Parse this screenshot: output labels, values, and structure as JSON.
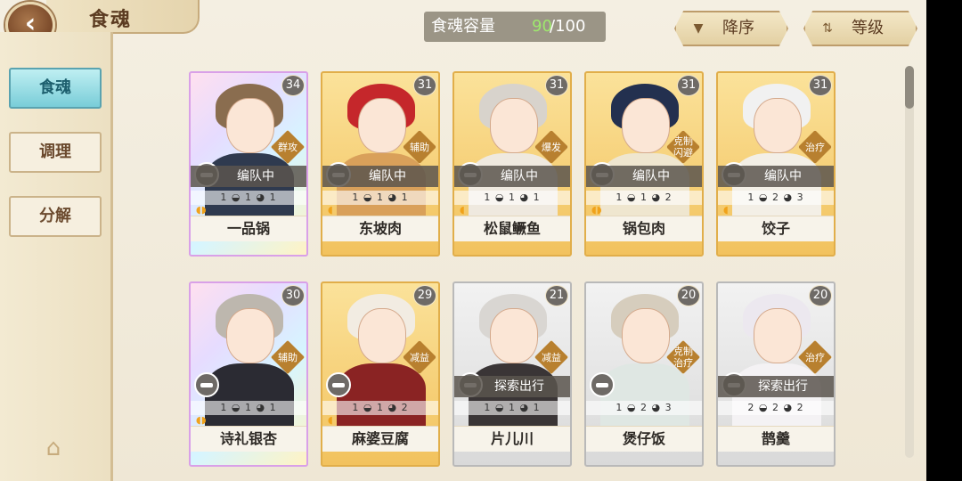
{
  "header": {
    "title": "食魂",
    "capacity_label": "食魂容量",
    "capacity_current": "90",
    "capacity_total": "/100",
    "sort_label": "降序",
    "level_label": "等级",
    "colors": {
      "capacity_current": "#9ee86d",
      "accent_tab": "#79cdd8"
    }
  },
  "sidebar": {
    "tabs": [
      {
        "label": "食魂",
        "active": true
      },
      {
        "label": "调理",
        "active": false
      },
      {
        "label": "分解",
        "active": false
      }
    ]
  },
  "cards": [
    {
      "name": "一品锅",
      "level": "34",
      "role": "群攻",
      "status": "编队中",
      "stats": "1 ◒ 1 ◕ 1",
      "flames": "◖◗",
      "rarity": "rainbow",
      "hair": "#8a6d4f",
      "body": "#2f3a4f"
    },
    {
      "name": "东坡肉",
      "level": "31",
      "role": "辅助",
      "status": "编队中",
      "stats": "1 ◒ 1 ◕ 1",
      "flames": "◖",
      "rarity": "gold",
      "hair": "#c5272b",
      "body": "#d9a05a"
    },
    {
      "name": "松鼠鳜鱼",
      "level": "31",
      "role": "爆发",
      "status": "编队中",
      "stats": "1 ◒ 1 ◕ 1",
      "flames": "◖",
      "rarity": "gold",
      "hair": "#d8d3cc",
      "body": "#efe9df"
    },
    {
      "name": "锅包肉",
      "level": "31",
      "role": "克制闪避",
      "status": "编队中",
      "stats": "1 ◒ 1 ◕ 2",
      "flames": "◖◗",
      "rarity": "gold",
      "hair": "#23304f",
      "body": "#efe6cf"
    },
    {
      "name": "饺子",
      "level": "31",
      "role": "治疗",
      "status": "编队中",
      "stats": "1 ◒ 2 ◕ 3",
      "flames": "◖",
      "rarity": "gold",
      "hair": "#f1f1f1",
      "body": "#f3efe6"
    },
    {
      "name": "诗礼银杏",
      "level": "30",
      "role": "辅助",
      "status": "",
      "stats": "1 ◒ 1 ◕ 1",
      "flames": "◖◗",
      "rarity": "rainbow",
      "hair": "#bdb7ae",
      "body": "#2b2b33"
    },
    {
      "name": "麻婆豆腐",
      "level": "29",
      "role": "减益",
      "status": "",
      "stats": "1 ◒ 1 ◕ 2",
      "flames": "◖",
      "rarity": "gold",
      "hair": "#f2ece2",
      "body": "#8a2323"
    },
    {
      "name": "片儿川",
      "level": "21",
      "role": "减益",
      "status": "探索出行",
      "stats": "1 ◒ 1 ◕ 1",
      "flames": "",
      "rarity": "silver",
      "hair": "#d9d6d2",
      "body": "#3a3536"
    },
    {
      "name": "煲仔饭",
      "level": "20",
      "role": "克制治疗",
      "status": "",
      "stats": "1 ◒ 2 ◕ 3",
      "flames": "",
      "rarity": "silver",
      "hair": "#d6cdbd",
      "body": "#dfe7e3"
    },
    {
      "name": "鹊羹",
      "level": "20",
      "role": "治疗",
      "status": "探索出行",
      "stats": "2 ◒ 2 ◕ 2",
      "flames": "",
      "rarity": "silver",
      "hair": "#ece8ef",
      "body": "#f4f2f4"
    }
  ]
}
